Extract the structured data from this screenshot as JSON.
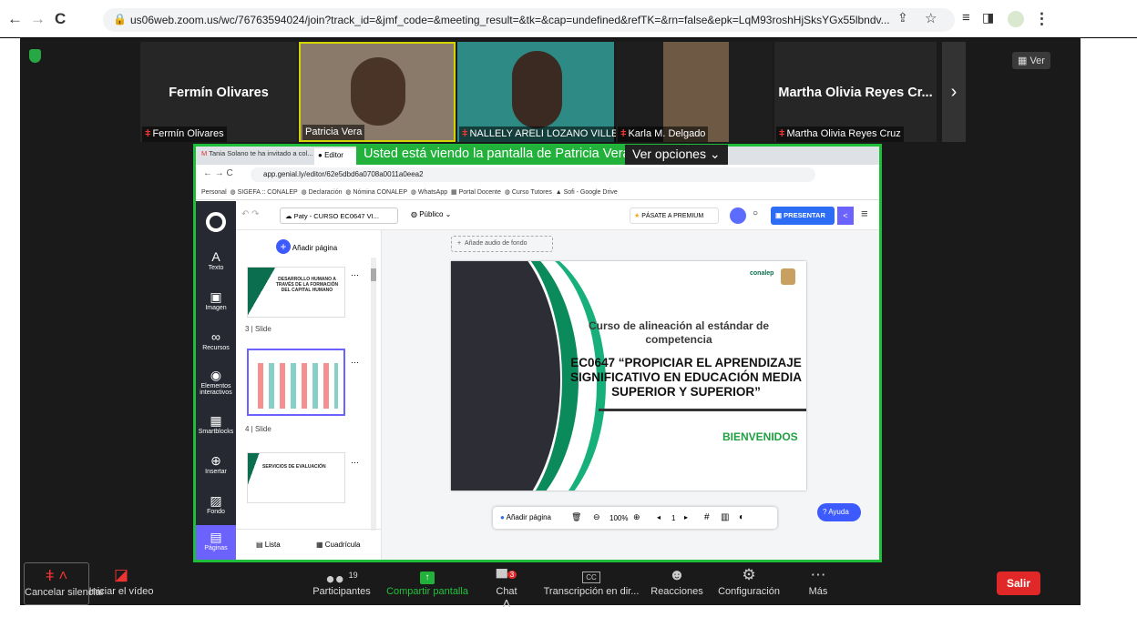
{
  "browser": {
    "url": "us06web.zoom.us/wc/76763594024/join?track_id=&jmf_code=&meeting_result=&tk=&cap=undefined&refTK=&rn=false&epk=LqM93roshHjSksYGx55lbndv..."
  },
  "participants": [
    {
      "big": "Fermín Olivares",
      "name": "Fermín Olivares",
      "muted": true
    },
    {
      "big": "",
      "name": "Patricia Vera",
      "muted": false
    },
    {
      "big": "",
      "name": "NALLELY ARELI LOZANO VILLEDA",
      "muted": true
    },
    {
      "big": "",
      "name": "Karla M. Delgado",
      "muted": true
    },
    {
      "big": "Martha Olivia Reyes Cr...",
      "name": "Martha Olivia Reyes Cruz",
      "muted": true
    }
  ],
  "view_label": "Ver",
  "banner": {
    "viewing": "Usted está viendo la pantalla de Patricia Vera",
    "options": "Ver opciones"
  },
  "shared": {
    "tab1": "Tania Solano te ha invitado a col...",
    "tab2": "Editor",
    "url": "app.genial.ly/editor/62e5dbd6a0708a0011a0eea2",
    "bookmarks": [
      "Personal",
      "SIGEFA :: CONALEP",
      "Declaración",
      "Nómina CONALEP",
      "WhatsApp",
      "Portal Docente",
      "Curso Tutores",
      "Sofi - Google Drive"
    ],
    "file": "Paty - CURSO EC0647 VI...",
    "visibility": "Público",
    "premium": "PÁSATE A PREMIUM",
    "present": "PRESENTAR",
    "sidebar": [
      {
        "icon": "A",
        "label": "Texto"
      },
      {
        "icon": "▣",
        "label": "Imagen"
      },
      {
        "icon": "∞",
        "label": "Recursos"
      },
      {
        "icon": "◉",
        "label": "Elementos interactivos"
      },
      {
        "icon": "▦",
        "label": "Smartblocks"
      },
      {
        "icon": "⊕",
        "label": "Insertar"
      },
      {
        "icon": "▨",
        "label": "Fondo"
      },
      {
        "icon": "▤",
        "label": "Páginas"
      }
    ],
    "add_page": "Añadir página",
    "slide3": "3 | Slide",
    "slide4": "4 | Slide",
    "thumb3": "DESARROLLO HUMANO A TRAVÉS DE LA FORMACIÓN DEL CAPITAL HUMANO",
    "thumb5": "SERVICIOS DE EVALUACIÓN",
    "list": "Lista",
    "grid": "Cuadrícula",
    "audio": "Añade audio de fondo",
    "slide_title": "Curso de alineación al estándar de competencia",
    "slide_main": "EC0647 “PROPICIAR EL APRENDIZAJE SIGNIFICATIVO EN EDUCACIÓN MEDIA SUPERIOR Y SUPERIOR”",
    "slide_welcome": "BIENVENIDOS",
    "logo": "conalep",
    "bottom_add": "Añadir página",
    "zoom": "100%",
    "page": "1",
    "help": "Ayuda"
  },
  "toolbar": {
    "mute": "Cancelar silenciar",
    "video": "Iniciar el vídeo",
    "participants": "Participantes",
    "participants_count": "19",
    "share": "Compartir pantalla",
    "chat": "Chat",
    "chat_badge": "3",
    "captions": "Transcripción en dir...",
    "reactions": "Reacciones",
    "settings": "Configuración",
    "more": "Más",
    "leave": "Salir"
  },
  "colors": {
    "green": "#1fbe3a",
    "red": "#e02828",
    "teal": "#0b8a5c"
  }
}
